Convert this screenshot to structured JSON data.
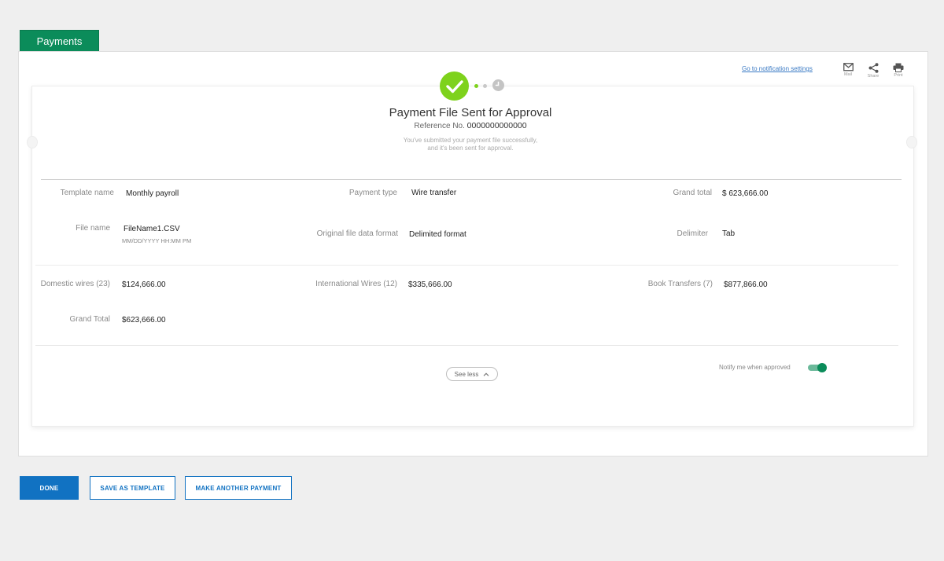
{
  "tab": {
    "label": "Payments"
  },
  "header": {
    "notification_link": "Go to notification settings",
    "tools": {
      "mail": "Mail",
      "share": "Share",
      "print": "Print"
    }
  },
  "status": {
    "title": "Payment File Sent for Approval",
    "reference_label": "Reference No.",
    "reference_number": "0000000000000",
    "message_line1": "You've submitted your payment file successfully,",
    "message_line2": "and it's been sent for approval."
  },
  "details": {
    "template_name_label": "Template name",
    "template_name_value": "Monthly payroll",
    "payment_type_label": "Payment type",
    "payment_type_value": "Wire transfer",
    "grand_total_label": "Grand total",
    "grand_total_value": "$ 623,666.00",
    "file_name_label": "File name",
    "file_name_value": "FileName1.CSV",
    "file_date_value": "MM/DD/YYYY HH:MM PM",
    "original_format_label": "Original file data format",
    "original_format_value": "Delimited format",
    "delimiter_label": "Delimiter",
    "delimiter_value": "Tab"
  },
  "summary": {
    "domestic_label": "Domestic wires (23)",
    "domestic_value": "$124,666.00",
    "international_label": "International Wires (12)",
    "international_value": "$335,666.00",
    "book_label": "Book Transfers (7)",
    "book_value": "$877,866.00",
    "grand_total_label": "Grand Total",
    "grand_total_value": "$623,666.00"
  },
  "footer": {
    "see_less": "See less",
    "notify_label": "Notify me when  approved",
    "notify_enabled": true
  },
  "actions": {
    "done": "DONE",
    "save_template": "SAVE AS TEMPLATE",
    "another_payment": "MAKE ANOTHER PAYMENT"
  },
  "colors": {
    "brand_green": "#0b8c5a",
    "success": "#7ed21c",
    "primary_blue": "#1172c2"
  }
}
